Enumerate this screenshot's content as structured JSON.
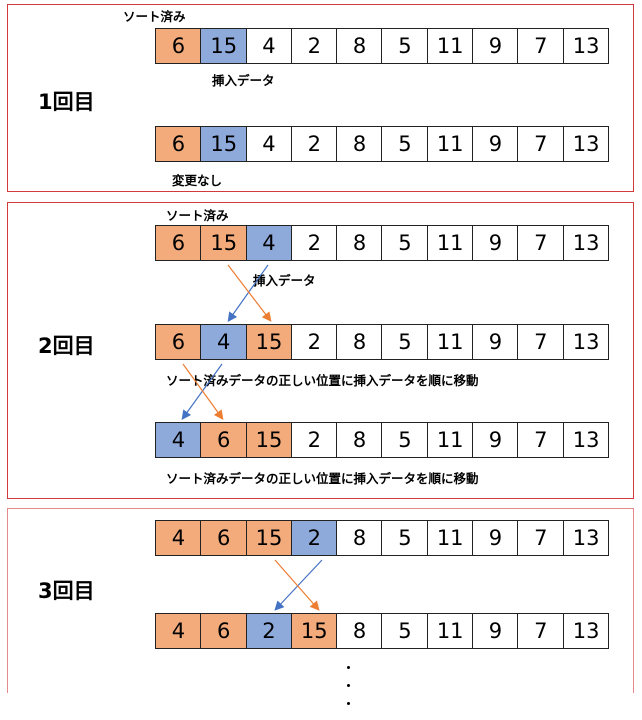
{
  "labels": {
    "sorted": "ソート済み",
    "insert_data": "挿入データ",
    "no_change": "変更なし",
    "move_note": "ソート済みデータの正しい位置に挿入データを順に移動"
  },
  "rounds": [
    {
      "title": "1回目",
      "rows": [
        {
          "cells": [
            {
              "value": "6",
              "state": "sorted"
            },
            {
              "value": "15",
              "state": "insert"
            },
            {
              "value": "4",
              "state": "plain"
            },
            {
              "value": "2",
              "state": "plain"
            },
            {
              "value": "8",
              "state": "plain"
            },
            {
              "value": "5",
              "state": "plain"
            },
            {
              "value": "11",
              "state": "plain"
            },
            {
              "value": "9",
              "state": "plain"
            },
            {
              "value": "7",
              "state": "plain"
            },
            {
              "value": "13",
              "state": "plain"
            }
          ]
        },
        {
          "cells": [
            {
              "value": "6",
              "state": "sorted"
            },
            {
              "value": "15",
              "state": "insert"
            },
            {
              "value": "4",
              "state": "plain"
            },
            {
              "value": "2",
              "state": "plain"
            },
            {
              "value": "8",
              "state": "plain"
            },
            {
              "value": "5",
              "state": "plain"
            },
            {
              "value": "11",
              "state": "plain"
            },
            {
              "value": "9",
              "state": "plain"
            },
            {
              "value": "7",
              "state": "plain"
            },
            {
              "value": "13",
              "state": "plain"
            }
          ]
        }
      ]
    },
    {
      "title": "2回目",
      "rows": [
        {
          "cells": [
            {
              "value": "6",
              "state": "sorted"
            },
            {
              "value": "15",
              "state": "sorted"
            },
            {
              "value": "4",
              "state": "insert"
            },
            {
              "value": "2",
              "state": "plain"
            },
            {
              "value": "8",
              "state": "plain"
            },
            {
              "value": "5",
              "state": "plain"
            },
            {
              "value": "11",
              "state": "plain"
            },
            {
              "value": "9",
              "state": "plain"
            },
            {
              "value": "7",
              "state": "plain"
            },
            {
              "value": "13",
              "state": "plain"
            }
          ]
        },
        {
          "cells": [
            {
              "value": "6",
              "state": "sorted"
            },
            {
              "value": "4",
              "state": "insert"
            },
            {
              "value": "15",
              "state": "sorted"
            },
            {
              "value": "2",
              "state": "plain"
            },
            {
              "value": "8",
              "state": "plain"
            },
            {
              "value": "5",
              "state": "plain"
            },
            {
              "value": "11",
              "state": "plain"
            },
            {
              "value": "9",
              "state": "plain"
            },
            {
              "value": "7",
              "state": "plain"
            },
            {
              "value": "13",
              "state": "plain"
            }
          ]
        },
        {
          "cells": [
            {
              "value": "4",
              "state": "insert"
            },
            {
              "value": "6",
              "state": "sorted"
            },
            {
              "value": "15",
              "state": "sorted"
            },
            {
              "value": "2",
              "state": "plain"
            },
            {
              "value": "8",
              "state": "plain"
            },
            {
              "value": "5",
              "state": "plain"
            },
            {
              "value": "11",
              "state": "plain"
            },
            {
              "value": "9",
              "state": "plain"
            },
            {
              "value": "7",
              "state": "plain"
            },
            {
              "value": "13",
              "state": "plain"
            }
          ]
        }
      ]
    },
    {
      "title": "3回目",
      "rows": [
        {
          "cells": [
            {
              "value": "4",
              "state": "sorted"
            },
            {
              "value": "6",
              "state": "sorted"
            },
            {
              "value": "15",
              "state": "sorted"
            },
            {
              "value": "2",
              "state": "insert"
            },
            {
              "value": "8",
              "state": "plain"
            },
            {
              "value": "5",
              "state": "plain"
            },
            {
              "value": "11",
              "state": "plain"
            },
            {
              "value": "9",
              "state": "plain"
            },
            {
              "value": "7",
              "state": "plain"
            },
            {
              "value": "13",
              "state": "plain"
            }
          ]
        },
        {
          "cells": [
            {
              "value": "4",
              "state": "sorted"
            },
            {
              "value": "6",
              "state": "sorted"
            },
            {
              "value": "2",
              "state": "insert"
            },
            {
              "value": "15",
              "state": "sorted"
            },
            {
              "value": "8",
              "state": "plain"
            },
            {
              "value": "5",
              "state": "plain"
            },
            {
              "value": "11",
              "state": "plain"
            },
            {
              "value": "9",
              "state": "plain"
            },
            {
              "value": "7",
              "state": "plain"
            },
            {
              "value": "13",
              "state": "plain"
            }
          ]
        }
      ]
    }
  ],
  "colors": {
    "sorted_fill": "#f3ab7c",
    "insert_fill": "#8eaadb",
    "blue_arrow": "#4472c4",
    "orange_arrow": "#ed7d31",
    "panel_border": "#d33a3a"
  }
}
